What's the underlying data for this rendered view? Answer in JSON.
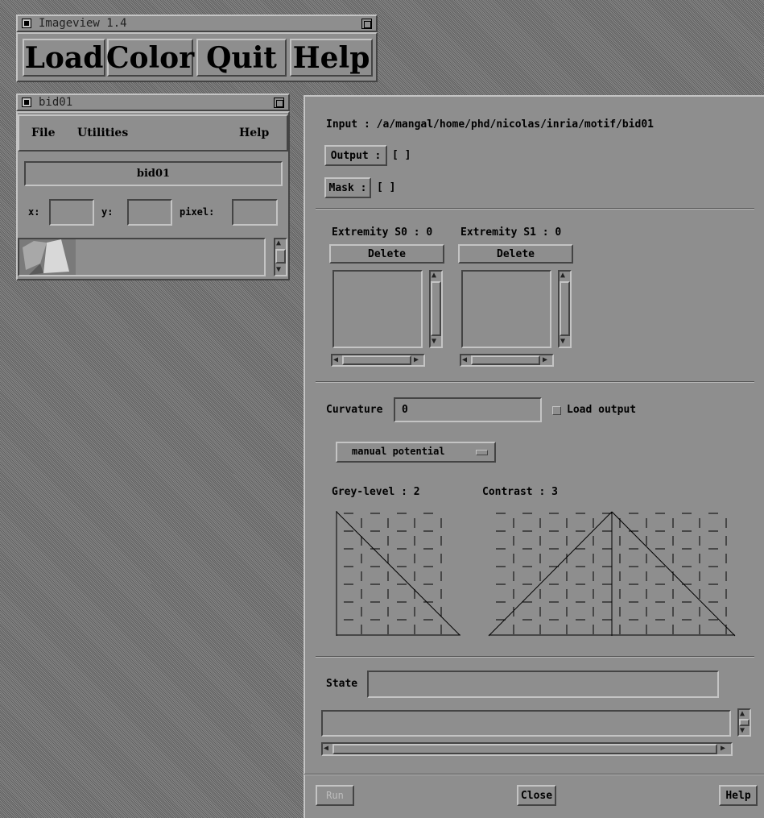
{
  "imageview": {
    "title": "Imageview 1.4",
    "buttons": [
      "Load",
      "Color",
      "Quit",
      "Help"
    ]
  },
  "bidwin": {
    "title": "bid01",
    "menu": {
      "file": "File",
      "utilities": "Utilities",
      "help": "Help"
    },
    "image_name": "bid01",
    "x_label": "x:",
    "y_label": "y:",
    "pixel_label": "pixel:"
  },
  "dialog": {
    "input": "Input : /a/mangal/home/phd/nicolas/inria/motif/bid01",
    "output_button": "Output :",
    "output_value": "[ ]",
    "mask_button": "Mask :",
    "mask_value": "[ ]",
    "extremity_s0": "Extremity S0 : 0",
    "extremity_s1": "Extremity S1 : 0",
    "delete_label": "Delete",
    "curvature_label": "Curvature",
    "curvature_value": "0",
    "load_output_label": "Load output",
    "potential_option": "manual potential",
    "grey_level": "Grey-level : 2",
    "contrast": "Contrast : 3",
    "state_label": "State",
    "state_value": "",
    "run_label": "Run",
    "close_label": "Close",
    "help_label": "Help"
  }
}
